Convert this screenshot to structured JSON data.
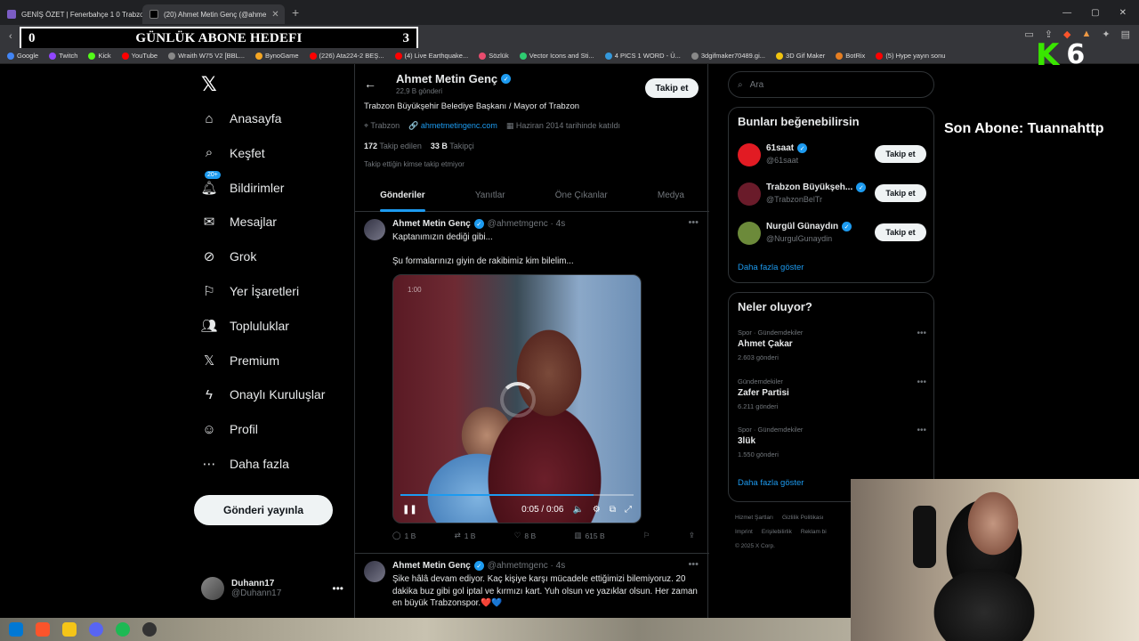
{
  "browser": {
    "tabs": [
      {
        "title": "GENİŞ ÖZET | Fenerbahçe 1 0 Trabzo",
        "active": false
      },
      {
        "title": "(20) Ahmet Metin Genç (@ahme",
        "active": true
      }
    ],
    "new_tab": "+",
    "url_partial": "x.com",
    "bookmarks": [
      {
        "label": "Google",
        "color": "#4285f4"
      },
      {
        "label": "Twitch",
        "color": "#9146ff"
      },
      {
        "label": "Kick",
        "color": "#53fc18"
      },
      {
        "label": "YouTube",
        "color": "#ff0000"
      },
      {
        "label": "Wraith W75 V2 [BBL...",
        "color": "#888888"
      },
      {
        "label": "BynoGame",
        "color": "#f5a623"
      },
      {
        "label": "(226) Ata224-2 BEŞ...",
        "color": "#ff0000"
      },
      {
        "label": "(4) Live Earthquake...",
        "color": "#ff0000"
      },
      {
        "label": "Sözlük",
        "color": "#e84c6e"
      },
      {
        "label": "Vector Icons and Sti...",
        "color": "#2ecc71"
      },
      {
        "label": "4 PICS 1 WORD - Ü...",
        "color": "#3498db"
      },
      {
        "label": "3dgifmaker70489.gi...",
        "color": "#888888"
      },
      {
        "label": "3D Gif Maker",
        "color": "#f1c40f"
      },
      {
        "label": "BotRix",
        "color": "#e67e22"
      },
      {
        "label": "(5) Hype yayın sonu",
        "color": "#ff0000"
      }
    ]
  },
  "overlay": {
    "goal_left": "0",
    "goal_title": "GÜNLÜK ABONE HEDEFI",
    "goal_right": "3",
    "k_letter": "K",
    "k_count": "6",
    "last_sub": "Son Abone: Tuannahttp"
  },
  "nav": {
    "items": [
      {
        "label": "Anasayfa",
        "icon": "home-icon"
      },
      {
        "label": "Keşfet",
        "icon": "search-icon"
      },
      {
        "label": "Bildirimler",
        "icon": "bell-icon",
        "badge": "20+"
      },
      {
        "label": "Mesajlar",
        "icon": "mail-icon"
      },
      {
        "label": "Grok",
        "icon": "grok-icon"
      },
      {
        "label": "Yer İşaretleri",
        "icon": "bookmark-icon"
      },
      {
        "label": "Topluluklar",
        "icon": "people-icon"
      },
      {
        "label": "Premium",
        "icon": "x-logo-icon"
      },
      {
        "label": "Onaylı Kuruluşlar",
        "icon": "lightning-icon"
      },
      {
        "label": "Profil",
        "icon": "person-icon"
      },
      {
        "label": "Daha fazla",
        "icon": "more-circle-icon"
      }
    ],
    "post_button": "Gönderi yayınla",
    "account": {
      "name": "Duhann17",
      "handle": "@Duhann17"
    }
  },
  "profile": {
    "name": "Ahmet Metin Genç",
    "posts": "22,9 B gönderi",
    "follow": "Takip et",
    "bio": "Trabzon Büyükşehir Belediye Başkanı / Mayor of Trabzon",
    "location": "Trabzon",
    "website": "ahmetmetingenc.com",
    "joined": "Haziran 2014 tarihinde katıldı",
    "following_count": "172",
    "following_label": "Takip edilen",
    "followers_count": "33 B",
    "followers_label": "Takipçi",
    "no_mutual": "Takip ettiğin kimse takip etmiyor",
    "tabs": [
      "Gönderiler",
      "Yanıtlar",
      "Öne Çıkanlar",
      "Medya"
    ]
  },
  "tweets": [
    {
      "name": "Ahmet Metin Genç",
      "handle": "@ahmetmgenc · 4s",
      "text": "Kaptanımızın dediği gibi...",
      "text2": "Şu formalarınızı giyin de rakibimiz kim bilelim...",
      "video": {
        "time_top": "1:00",
        "time": "0:05 / 0:06",
        "progress": 0.83
      },
      "replies": "1 B",
      "reposts": "1 B",
      "likes": "8 B",
      "views": "615 B"
    },
    {
      "name": "Ahmet Metin Genç",
      "handle": "@ahmetmgenc · 4s",
      "text": "Şike hâlâ devam ediyor. Kaç kişiye karşı mücadele ettiğimizi bilemiyoruz. 20 dakika buz gibi gol iptal ve kırmızı kart. Yuh olsun ve yazıklar olsun. Her zaman en büyük Trabzonspor.❤️💙"
    }
  ],
  "right": {
    "search_placeholder": "Ara",
    "suggest_title": "Bunları beğenebilirsin",
    "suggestions": [
      {
        "name": "61saat",
        "handle": "@61saat",
        "color": "#e21b23"
      },
      {
        "name": "Trabzon Büyükşeh...",
        "handle": "@TrabzonBelTr",
        "color": "#6a1b2a"
      },
      {
        "name": "Nurgül Günaydın",
        "handle": "@NurgulGunaydin",
        "color": "#6c8a3a"
      }
    ],
    "follow_label": "Takip et",
    "show_more": "Daha fazla göster",
    "trends_title": "Neler oluyor?",
    "trends": [
      {
        "category": "Spor · Gündemdekiler",
        "title": "Ahmet Çakar",
        "count": "2.603 gönderi"
      },
      {
        "category": "Gündemdekiler",
        "title": "Zafer Partisi",
        "count": "6.211 gönderi"
      },
      {
        "category": "Spor · Gündemdekiler",
        "title": "3lük",
        "count": "1.550 gönderi"
      }
    ],
    "footer": [
      "Hizmet Şartları",
      "Gizlilik Politikası",
      "Imprint",
      "Erişilebilirlik",
      "Reklam bi",
      "© 2025 X Corp."
    ]
  },
  "colors": {
    "accent": "#1d9bf0",
    "bg": "#000000",
    "border": "#2f3336",
    "muted": "#71767b"
  }
}
